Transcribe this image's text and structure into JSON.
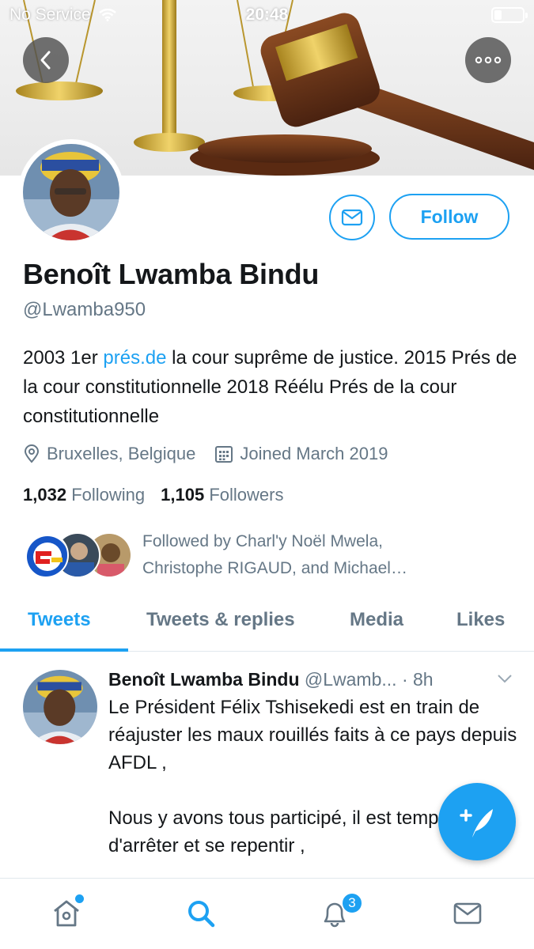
{
  "status_bar": {
    "carrier": "No Service",
    "time": "20:48",
    "battery_level": 0.25
  },
  "profile": {
    "name": "Benoît Lwamba Bindu",
    "handle": "@Lwamba950",
    "bio_before": "2003 1er ",
    "bio_link": "prés.de",
    "bio_after": " la cour suprême de justice. 2015 Prés de la cour constitutionnelle 2018 Réélu Prés de la cour constitutionnelle",
    "location": "Bruxelles, Belgique",
    "joined": "Joined March 2019",
    "following_count": "1,032",
    "following_label": "Following",
    "followers_count": "1,105",
    "followers_label": "Followers",
    "followed_by_line1": "Followed by Charl'y Noël Mwela,",
    "followed_by_line2": "Christophe RIGAUD, and Michael…",
    "follow_label": "Follow"
  },
  "tabs": [
    {
      "label": "Tweets",
      "active": true
    },
    {
      "label": "Tweets & replies",
      "active": false
    },
    {
      "label": "Media",
      "active": false
    },
    {
      "label": "Likes",
      "active": false
    }
  ],
  "tweet": {
    "name": "Benoît Lwamba Bindu",
    "handle": "@Lwamb...",
    "time": "· 8h",
    "text": "Le Président Félix Tshisekedi est en train de réajuster les maux rouillés faits à ce pays depuis AFDL ,\n\nNous y avons tous participé, il est temps d'arrêter et se repentir ,"
  },
  "nav": {
    "notifications_badge": "3",
    "icons": [
      "home-icon",
      "search-icon",
      "notifications-icon",
      "messages-icon"
    ]
  },
  "colors": {
    "accent": "#1da1f2",
    "muted": "#657786",
    "text": "#14171a"
  }
}
